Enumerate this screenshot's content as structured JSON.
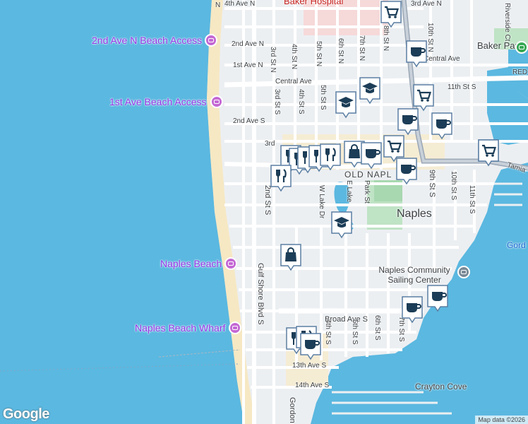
{
  "map": {
    "watermark": "Google",
    "attribution": "Map data ©2026"
  },
  "streets": [
    {
      "name": "4th Ave N"
    },
    {
      "name": "3rd Ave N"
    },
    {
      "name": "2nd Ave N"
    },
    {
      "name": "1st Ave N"
    },
    {
      "name": "Central Ave"
    },
    {
      "name": "Central Ave"
    },
    {
      "name": "2nd Ave S"
    },
    {
      "name": "3rd"
    },
    {
      "name": "3rd St N"
    },
    {
      "name": "4th St N"
    },
    {
      "name": "5th St N"
    },
    {
      "name": "6th St N"
    },
    {
      "name": "7th St N"
    },
    {
      "name": "8th St N"
    },
    {
      "name": "10th St N"
    },
    {
      "name": "3rd St S"
    },
    {
      "name": "4th St S"
    },
    {
      "name": "5th St S"
    },
    {
      "name": "6th"
    },
    {
      "name": "2nd St S"
    },
    {
      "name": "W Lake Dr"
    },
    {
      "name": "E Lake"
    },
    {
      "name": "Park St"
    },
    {
      "name": "9th St S"
    },
    {
      "name": "10th St S"
    },
    {
      "name": "11th St S"
    },
    {
      "name": "Gulf Shore Blvd S"
    },
    {
      "name": "Broad Ave S"
    },
    {
      "name": "4th St S"
    },
    {
      "name": "5th St S"
    },
    {
      "name": "6th St S"
    },
    {
      "name": "7th St S"
    },
    {
      "name": "13th Ave S"
    },
    {
      "name": "14th Ave S"
    },
    {
      "name": "Gordon"
    },
    {
      "name": "Tamia"
    },
    {
      "name": "Riverside Ct"
    },
    {
      "name": "th St"
    },
    {
      "name": "N"
    },
    {
      "name": "RED"
    }
  ],
  "places": [
    {
      "name": "2nd Ave N Beach Access",
      "type": "beach"
    },
    {
      "name": "1st Ave Beach Access",
      "type": "beach"
    },
    {
      "name": "Naples Beach",
      "type": "beach"
    },
    {
      "name": "Naples Beach Wharf",
      "type": "beach"
    }
  ],
  "areas": [
    {
      "name": "Baker Hospital"
    },
    {
      "name": "Baker Park"
    },
    {
      "name": "OLD NAPL"
    },
    {
      "name": "Naples"
    },
    {
      "name": "Naples Community Sailing Center"
    },
    {
      "name": "Crayton Cove"
    },
    {
      "name": "Gord"
    }
  ],
  "markers": [
    {
      "icon": "shopping-cart-icon"
    },
    {
      "icon": "coffee-cup-icon"
    },
    {
      "icon": "graduation-cap-icon"
    },
    {
      "icon": "graduation-cap-icon"
    },
    {
      "icon": "shopping-cart-icon"
    },
    {
      "icon": "coffee-cup-icon"
    },
    {
      "icon": "coffee-cup-icon"
    },
    {
      "icon": "shopping-cart-icon"
    },
    {
      "icon": "utensils-icon"
    },
    {
      "icon": "utensils-icon"
    },
    {
      "icon": "utensils-icon"
    },
    {
      "icon": "utensils-icon"
    },
    {
      "icon": "utensils-icon"
    },
    {
      "icon": "shopping-bag-icon"
    },
    {
      "icon": "coffee-cup-icon"
    },
    {
      "icon": "shopping-cart-icon"
    },
    {
      "icon": "coffee-cup-icon"
    },
    {
      "icon": "utensils-icon"
    },
    {
      "icon": "graduation-cap-icon"
    },
    {
      "icon": "shopping-bag-icon"
    },
    {
      "icon": "coffee-cup-icon"
    },
    {
      "icon": "coffee-cup-icon"
    },
    {
      "icon": "utensils-icon"
    },
    {
      "icon": "utensils-icon"
    },
    {
      "icon": "coffee-cup-icon"
    },
    {
      "icon": "shopping-cart-icon"
    }
  ]
}
